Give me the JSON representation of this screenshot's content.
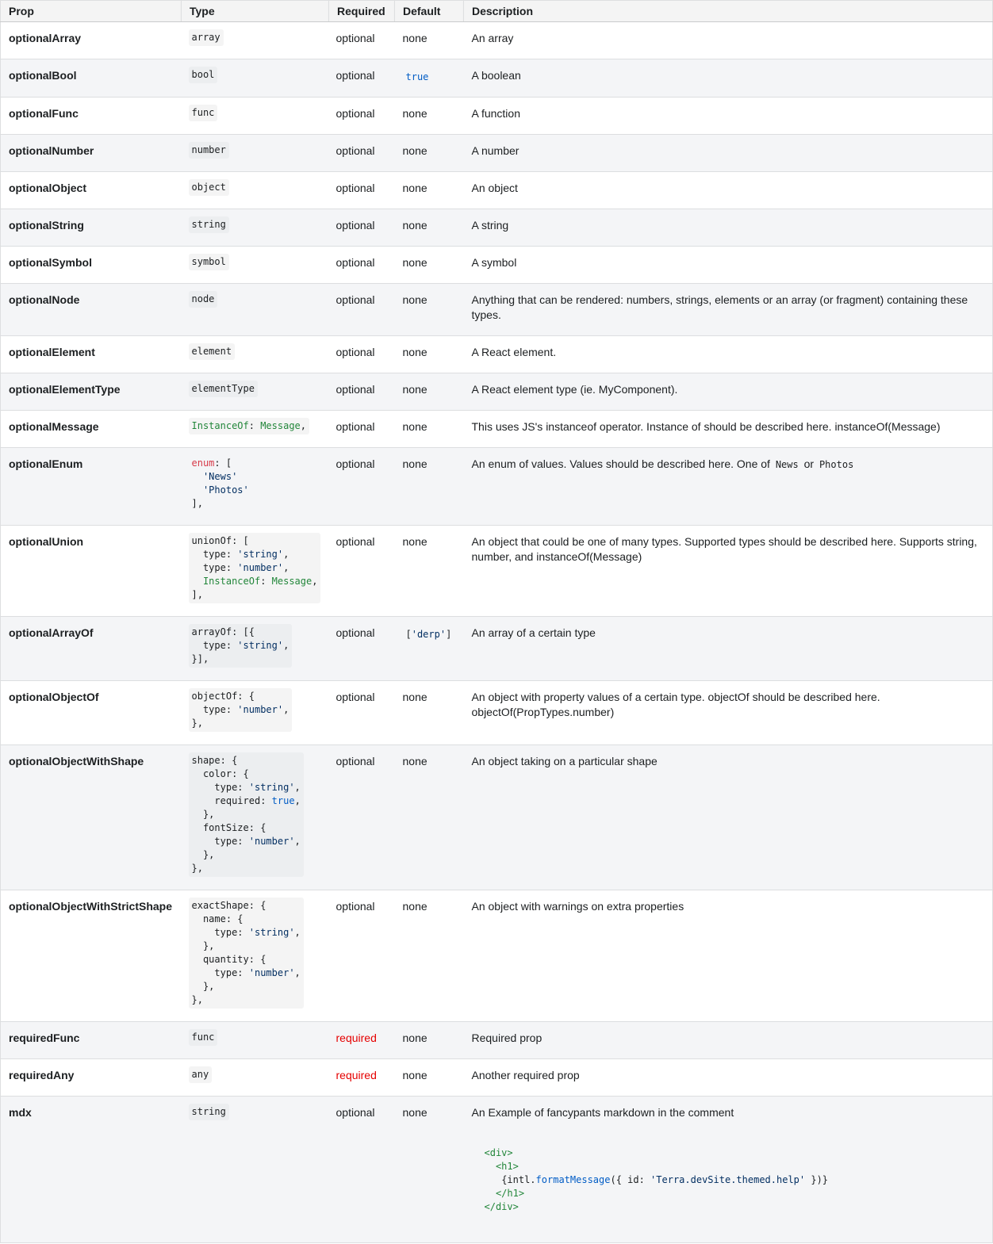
{
  "headers": {
    "prop": "Prop",
    "type": "Type",
    "required": "Required",
    "default": "Default",
    "description": "Description"
  },
  "rows": [
    {
      "prop": "optionalArray",
      "type": "array",
      "required": "optional",
      "default": "none",
      "description": "An array"
    },
    {
      "prop": "optionalBool",
      "type": "bool",
      "required": "optional",
      "default": "true",
      "description": "A boolean"
    },
    {
      "prop": "optionalFunc",
      "type": "func",
      "required": "optional",
      "default": "none",
      "description": "A function"
    },
    {
      "prop": "optionalNumber",
      "type": "number",
      "required": "optional",
      "default": "none",
      "description": "A number"
    },
    {
      "prop": "optionalObject",
      "type": "object",
      "required": "optional",
      "default": "none",
      "description": "An object"
    },
    {
      "prop": "optionalString",
      "type": "string",
      "required": "optional",
      "default": "none",
      "description": "A string"
    },
    {
      "prop": "optionalSymbol",
      "type": "symbol",
      "required": "optional",
      "default": "none",
      "description": "A symbol"
    },
    {
      "prop": "optionalNode",
      "type": "node",
      "required": "optional",
      "default": "none",
      "description": "Anything that can be rendered: numbers, strings, elements or an array (or fragment) containing these types."
    },
    {
      "prop": "optionalElement",
      "type": "element",
      "required": "optional",
      "default": "none",
      "description": "A React element."
    },
    {
      "prop": "optionalElementType",
      "type": "elementType",
      "required": "optional",
      "default": "none",
      "description": "A React element type (ie. MyComponent)."
    },
    {
      "prop": "optionalMessage",
      "type_parts": [
        "InstanceOf",
        ": ",
        "Message",
        ","
      ],
      "required": "optional",
      "default": "none",
      "description": "This uses JS's instanceof operator. Instance of should be described here. instanceOf(Message)"
    },
    {
      "prop": "optionalEnum",
      "type_parts": [
        "enum",
        ": [",
        "  ",
        "'News'",
        "  ",
        "'Photos'",
        "],"
      ],
      "required": "optional",
      "default": "none",
      "description_parts": [
        "An enum of values. Values should be described here. One of",
        "News",
        "or",
        "Photos"
      ]
    },
    {
      "prop": "optionalUnion",
      "type_parts": [
        "unionOf: [",
        "  type: ",
        "'string'",
        ",",
        "  type: ",
        "'number'",
        ",",
        "  ",
        "InstanceOf",
        ": ",
        "Message",
        ",",
        "],"
      ],
      "required": "optional",
      "default": "none",
      "description": "An object that could be one of many types. Supported types should be described here. Supports string, number, and instanceOf(Message)"
    },
    {
      "prop": "optionalArrayOf",
      "type_parts": [
        "arrayOf: [{",
        "  type: ",
        "'string'",
        ",",
        "}],"
      ],
      "required": "optional",
      "default_parts": [
        "[",
        "'derp'",
        "]"
      ],
      "description": "An array of a certain type"
    },
    {
      "prop": "optionalObjectOf",
      "type_parts": [
        "objectOf: {",
        "  type: ",
        "'number'",
        ",",
        "},"
      ],
      "required": "optional",
      "default": "none",
      "description": "An object with property values of a certain type. objectOf should be described here. objectOf(PropTypes.number)"
    },
    {
      "prop": "optionalObjectWithShape",
      "type_parts": [
        "shape: {",
        "  color: {",
        "    type: ",
        "'string'",
        ",",
        "    required: ",
        "true",
        ",",
        "  },",
        "  fontSize: {",
        "    type: ",
        "'number'",
        ",",
        "  },",
        "},"
      ],
      "required": "optional",
      "default": "none",
      "description": "An object taking on a particular shape"
    },
    {
      "prop": "optionalObjectWithStrictShape",
      "type_parts": [
        "exactShape: {",
        "  name: {",
        "    type: ",
        "'string'",
        ",",
        "  },",
        "  quantity: {",
        "    type: ",
        "'number'",
        ",",
        "  },",
        "},"
      ],
      "required": "optional",
      "default": "none",
      "description": "An object with warnings on extra properties"
    },
    {
      "prop": "requiredFunc",
      "type": "func",
      "required": "required",
      "default": "none",
      "description": "Required prop"
    },
    {
      "prop": "requiredAny",
      "type": "any",
      "required": "required",
      "default": "none",
      "description": "Another required prop"
    },
    {
      "prop": "mdx",
      "type": "string",
      "required": "optional",
      "default": "none",
      "description": "An Example of fancypants markdown in the comment",
      "code_parts": [
        "<div>",
        "<h1>",
        "{intl.",
        "formatMessage",
        "({ id: ",
        "'Terra.devSite.themed.help'",
        " })}",
        "</h1>",
        "</div>"
      ]
    }
  ],
  "colors": {
    "required": "#e50000",
    "string": "#032f62",
    "keyword_green": "#22863a",
    "keyword_red": "#d73a49",
    "literal_blue": "#005cc5"
  }
}
